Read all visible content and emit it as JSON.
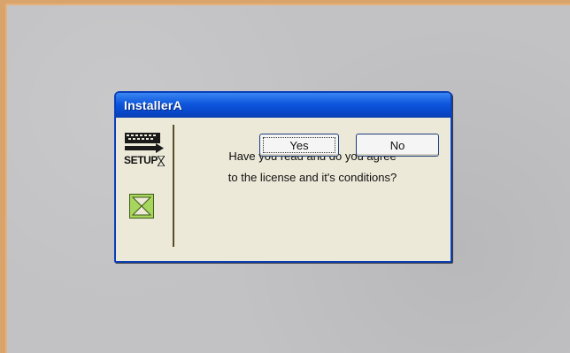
{
  "dialog": {
    "title": "InstallerA",
    "message_line1": "Have you read and do you agree",
    "message_line2": "to the license and it's conditions?",
    "yes_label": "Yes",
    "no_label": "No",
    "setup_label": "SETUP",
    "icons": [
      "setup-icon",
      "hourglass-icon"
    ]
  },
  "colors": {
    "background": "#c2c2c4",
    "title_bar": "#0d56dd",
    "dialog_body": "#ece9d8",
    "hourglass": "#7fc23a"
  }
}
